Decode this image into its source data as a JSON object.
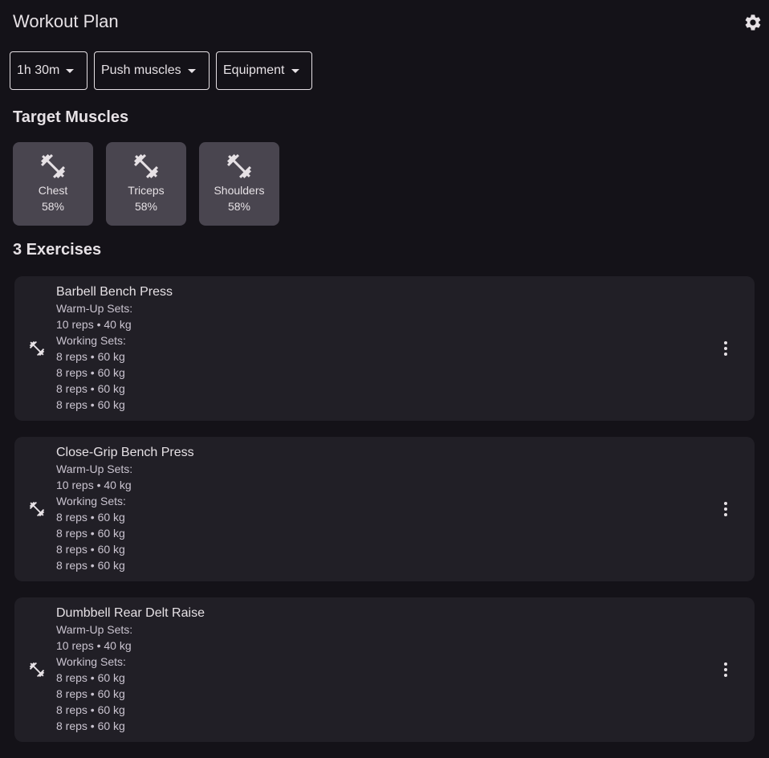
{
  "header": {
    "title": "Workout Plan",
    "settings_icon": "gear-icon"
  },
  "filters": [
    {
      "label": "1h 30m",
      "name": "duration"
    },
    {
      "label": "Push muscles",
      "name": "muscle-group"
    },
    {
      "label": "Equipment",
      "name": "equipment"
    }
  ],
  "target_muscles": {
    "heading": "Target Muscles",
    "items": [
      {
        "name": "Chest",
        "percent": "58%",
        "icon": "dumbbell-icon"
      },
      {
        "name": "Triceps",
        "percent": "58%",
        "icon": "dumbbell-icon"
      },
      {
        "name": "Shoulders",
        "percent": "58%",
        "icon": "dumbbell-icon"
      }
    ]
  },
  "exercises": {
    "heading": "3 Exercises",
    "items": [
      {
        "name": "Barbell Bench Press",
        "warmup_label": "Warm-Up Sets:",
        "warmup_sets": [
          "10 reps • 40 kg"
        ],
        "working_label": "Working Sets:",
        "working_sets": [
          "8 reps • 60 kg",
          "8 reps • 60 kg",
          "8 reps • 60 kg",
          "8 reps • 60 kg"
        ]
      },
      {
        "name": "Close-Grip Bench Press",
        "warmup_label": "Warm-Up Sets:",
        "warmup_sets": [
          "10 reps • 40 kg"
        ],
        "working_label": "Working Sets:",
        "working_sets": [
          "8 reps • 60 kg",
          "8 reps • 60 kg",
          "8 reps • 60 kg",
          "8 reps • 60 kg"
        ]
      },
      {
        "name": "Dumbbell Rear Delt Raise",
        "warmup_label": "Warm-Up Sets:",
        "warmup_sets": [
          "10 reps • 40 kg"
        ],
        "working_label": "Working Sets:",
        "working_sets": [
          "8 reps • 60 kg",
          "8 reps • 60 kg",
          "8 reps • 60 kg",
          "8 reps • 60 kg"
        ]
      }
    ]
  },
  "colors": {
    "background": "#141218",
    "card": "#211f26",
    "chip": "#49454f",
    "text": "#e6e1e5"
  }
}
